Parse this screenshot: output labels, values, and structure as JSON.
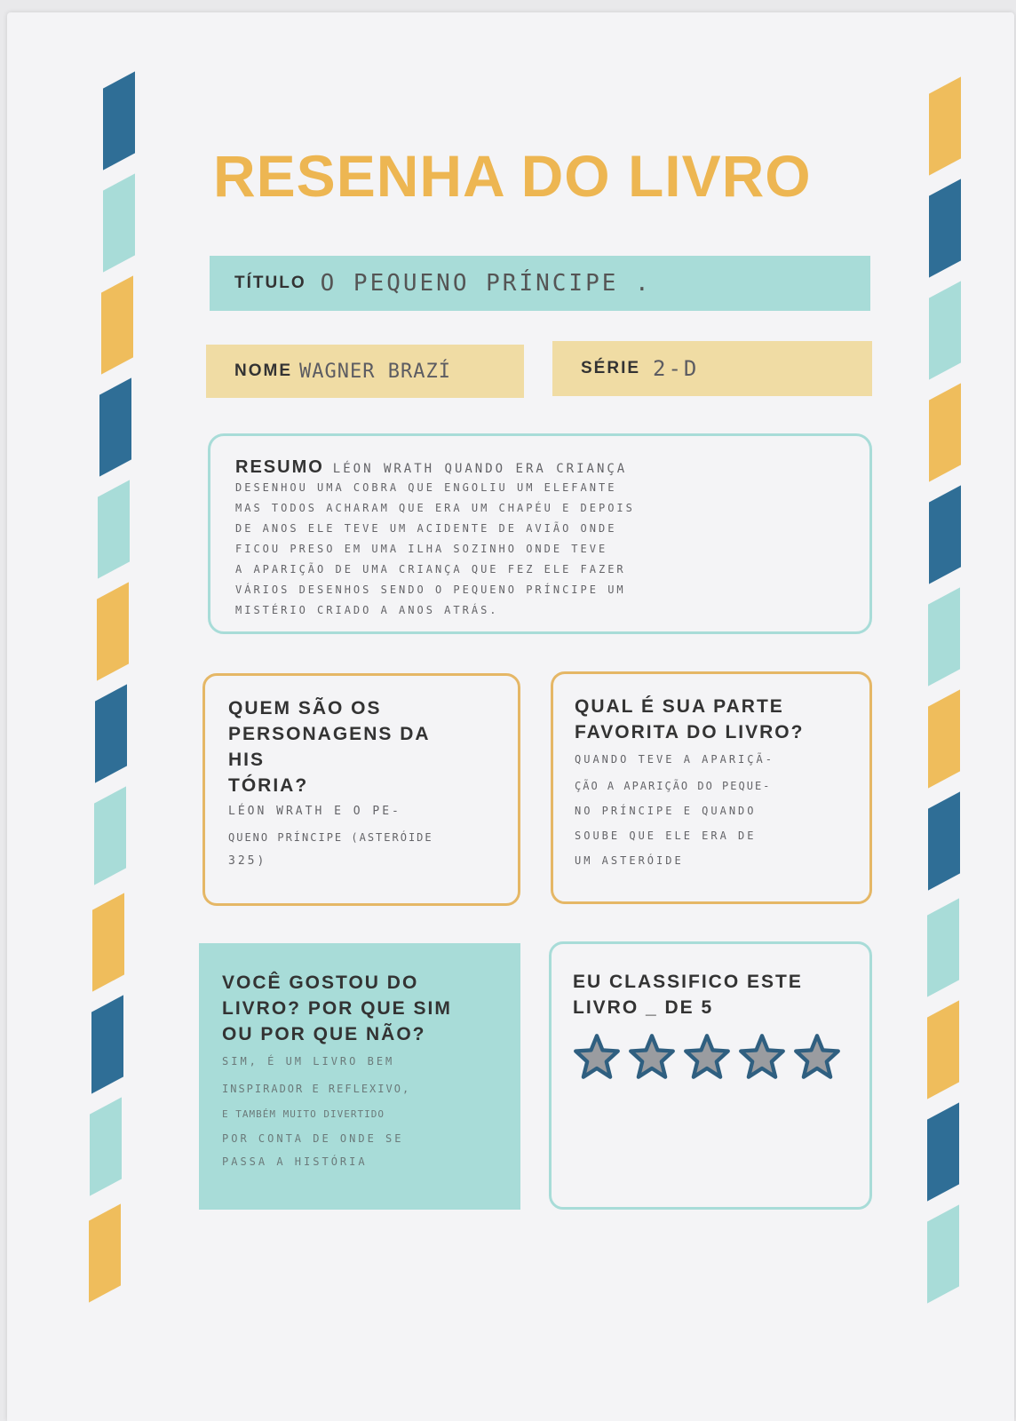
{
  "header": {
    "title": "RESENHA DO LIVRO"
  },
  "titulo": {
    "label": "TÍTULO",
    "value": "O PEQUENO PRÍNCIPE ."
  },
  "nome": {
    "label": "NOME",
    "value": "WAGNER  BRAZÍ"
  },
  "serie": {
    "label": "SÉRIE",
    "value": "2-D"
  },
  "resumo": {
    "label": "RESUMO",
    "lines": [
      "LÉON WRATH QUANDO ERA CRIANÇA",
      "DESENHOU UMA COBRA QUE ENGOLIU UM ELEFANTE",
      "MAS TODOS ACHARAM QUE ERA UM CHAPÉU E DEPOIS",
      "DE ANOS ELE TEVE UM ACIDENTE DE AVIÃO ONDE",
      "FICOU PRESO EM UMA ILHA SOZINHO ONDE TEVE",
      "A APARIÇÃO DE UMA CRIANÇA QUE FEZ ELE FAZER",
      "VÁRIOS DESENHOS SENDO O PEQUENO PRÍNCIPE UM",
      "MISTÉRIO CRIADO A ANOS ATRÁS."
    ]
  },
  "personagens": {
    "question_lines": [
      "QUEM SÃO OS",
      "PERSONAGENS DA",
      "HIS",
      "TÓRIA?"
    ],
    "answer_lines": [
      "LÉON WRATH E O PE-",
      "QUENO PRÍNCIPE (ASTERÓIDE",
      "325)"
    ]
  },
  "favorita": {
    "question_lines": [
      "QUAL É SUA PARTE",
      "FAVORITA DO LIVRO?"
    ],
    "answer_lines": [
      "QUANDO TEVE A APARIÇÃ-",
      "ÇÃO A APARIÇÃO DO PEQUE-",
      "NO PRÍNCIPE E QUANDO",
      "SOUBE QUE ELE ERA DE",
      "UM ASTERÓIDE"
    ]
  },
  "gostou": {
    "question_lines": [
      "VOCÊ GOSTOU DO",
      "LIVRO? POR QUE SIM",
      "OU POR QUE NÃO?"
    ],
    "answer_lines": [
      "SIM, É UM LIVRO BEM",
      "INSPIRADOR E REFLEXIVO,",
      "E TAMBÉM MUITO DIVERTIDO",
      "POR CONTA DE ONDE SE",
      "PASSA A HISTÓRIA"
    ]
  },
  "classifico": {
    "question_lines": [
      "EU CLASSIFICO ESTE",
      "LIVRO _ DE 5"
    ],
    "rating": 5,
    "max": 5
  },
  "colors": {
    "blue": "#2f6e96",
    "teal": "#a8dcd8",
    "yellow": "#efbd5c",
    "title": "#edb652",
    "tan": "#f0dca4",
    "orange_border": "#e5b766"
  }
}
